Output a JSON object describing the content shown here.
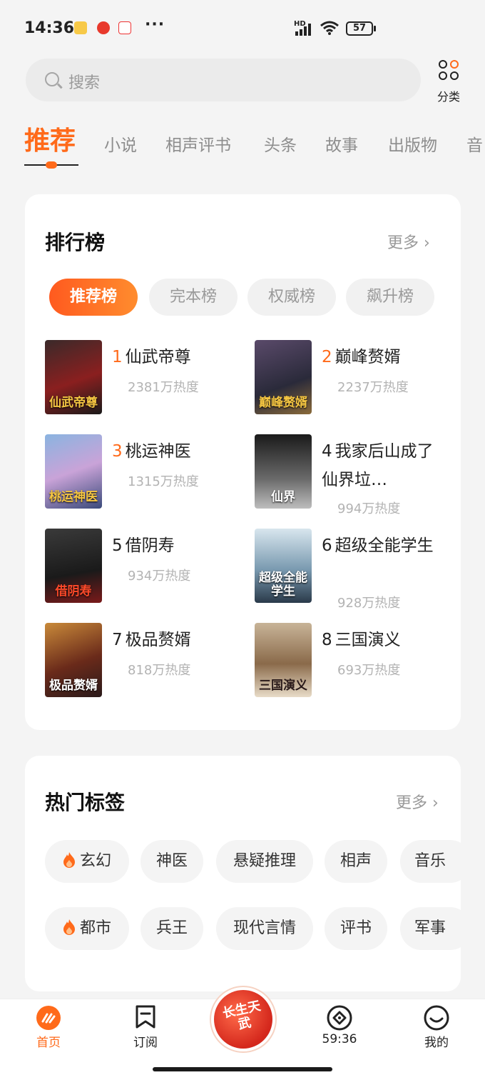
{
  "status": {
    "time": "14:36",
    "battery": "57",
    "network": "HD"
  },
  "search": {
    "placeholder": "搜索"
  },
  "category": {
    "label": "分类"
  },
  "tabs": [
    "推荐",
    "小说",
    "相声评书",
    "头条",
    "故事",
    "出版物",
    "音"
  ],
  "ranking": {
    "title": "排行榜",
    "more": "更多",
    "pills": [
      "推荐榜",
      "完本榜",
      "权威榜",
      "飙升榜"
    ],
    "books": [
      {
        "rank": "1",
        "name": "仙武帝尊",
        "heat": "2381万热度",
        "cover_text": "仙武帝尊"
      },
      {
        "rank": "2",
        "name": "巅峰赘婿",
        "heat": "2237万热度",
        "cover_text": "巅峰赘婿"
      },
      {
        "rank": "3",
        "name": "桃运神医",
        "heat": "1315万热度",
        "cover_text": "桃运神医"
      },
      {
        "rank": "4",
        "name": "我家后山成了仙界垃…",
        "heat": "994万热度",
        "cover_text": "仙界"
      },
      {
        "rank": "5",
        "name": "借阴寿",
        "heat": "934万热度",
        "cover_text": "借阴寿"
      },
      {
        "rank": "6",
        "name": "超级全能学生",
        "heat": "928万热度",
        "cover_text": "超级全能学生"
      },
      {
        "rank": "7",
        "name": "极品赘婿",
        "heat": "818万热度",
        "cover_text": "极品赘婿"
      },
      {
        "rank": "8",
        "name": "三国演义",
        "heat": "693万热度",
        "cover_text": "三国演义"
      }
    ]
  },
  "hot_tags": {
    "title": "热门标签",
    "more": "更多",
    "row1": [
      "玄幻",
      "神医",
      "悬疑推理",
      "相声",
      "音乐"
    ],
    "row2": [
      "都市",
      "兵王",
      "现代言情",
      "评书",
      "军事"
    ]
  },
  "bottom_nav": {
    "home": "首页",
    "subscribe": "订阅",
    "center_text": "长生天武",
    "timer": "59:36",
    "mine": "我的"
  },
  "colors": {
    "accent": "#ff6a1a",
    "background": "#f4f4f4"
  }
}
